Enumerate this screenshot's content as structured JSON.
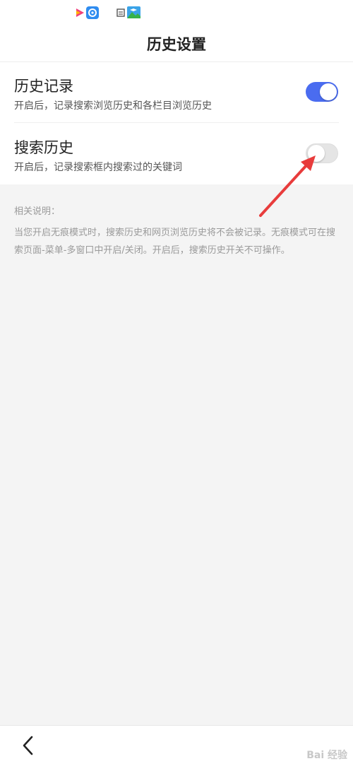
{
  "header": {
    "title": "历史设置"
  },
  "colors": {
    "toggle_on": "#4a6cf0",
    "toggle_off": "#e5e5e5",
    "annotation_arrow": "#e83c3c"
  },
  "status_bar": {
    "icons": [
      "video-app-icon",
      "browser-app-icon",
      "notification-icon",
      "gallery-app-icon"
    ]
  },
  "settings": [
    {
      "title": "历史记录",
      "description": "开启后，记录搜索浏览历史和各栏目浏览历史",
      "enabled": true
    },
    {
      "title": "搜索历史",
      "description": "开启后，记录搜索框内搜索过的关键词",
      "enabled": false
    }
  ],
  "notes": {
    "title": "相关说明：",
    "body": "当您开启无痕模式时，搜索历史和网页浏览历史将不会被记录。无痕模式可在搜索页面-菜单-多窗口中开启/关闭。开启后，搜索历史开关不可操作。"
  },
  "bottom_bar": {
    "back_icon": "chevron-left-icon"
  },
  "watermark": "Bai 经验"
}
